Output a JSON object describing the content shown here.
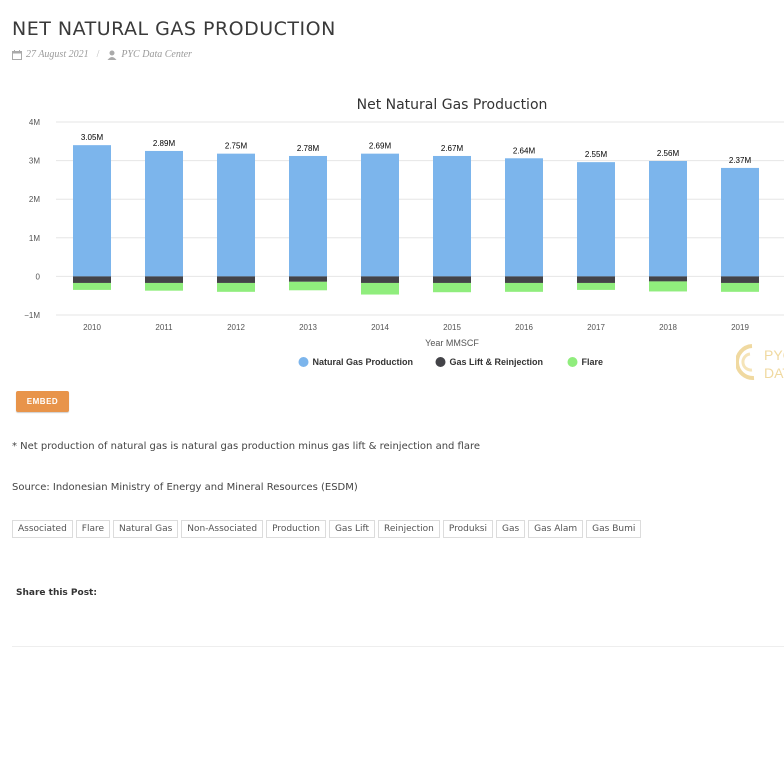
{
  "post": {
    "title": "NET NATURAL GAS PRODUCTION",
    "date": "27 August 2021",
    "author": "PYC Data Center"
  },
  "embed_label": "EMBED",
  "note": "* Net production of natural gas is natural gas production minus gas lift & reinjection and flare",
  "source": "Source: Indonesian Ministry of Energy and Mineral Resources (ESDM)",
  "tags": [
    "Associated",
    "Flare",
    "Natural Gas",
    "Non-Associated",
    "Production",
    "Gas Lift",
    "Reinjection",
    "Produksi",
    "Gas",
    "Gas Alam",
    "Gas Bumi"
  ],
  "share_label": "Share this Post:",
  "watermark_text": "PYC DATA",
  "colors": {
    "natural_gas": "#7cb5ec",
    "gas_lift": "#434348",
    "flare": "#90ed7d",
    "embed": "#e8944a"
  },
  "chart_data": {
    "type": "bar",
    "stacked": true,
    "title": "Net Natural Gas Production",
    "xlabel": "Year MMSCF",
    "ylabel": "",
    "ylim": [
      -1,
      4
    ],
    "yticks": [
      -1,
      0,
      1,
      2,
      3,
      4
    ],
    "ytick_labels": [
      "−1M",
      "0",
      "1M",
      "2M",
      "3M",
      "4M"
    ],
    "categories": [
      "2010",
      "2011",
      "2012",
      "2013",
      "2014",
      "2015",
      "2016",
      "2017",
      "2018",
      "2019"
    ],
    "series": [
      {
        "name": "Natural Gas Production",
        "color": "#7cb5ec",
        "values": [
          3.4,
          3.25,
          3.18,
          3.12,
          3.18,
          3.12,
          3.06,
          2.96,
          2.99,
          2.81
        ]
      },
      {
        "name": "Gas Lift & Reinjection",
        "color": "#434348",
        "values": [
          -0.17,
          -0.17,
          -0.17,
          -0.14,
          -0.17,
          -0.17,
          -0.17,
          -0.17,
          -0.13,
          -0.17
        ]
      },
      {
        "name": "Flare",
        "color": "#90ed7d",
        "values": [
          -0.18,
          -0.2,
          -0.23,
          -0.22,
          -0.3,
          -0.24,
          -0.23,
          -0.18,
          -0.26,
          -0.23
        ]
      }
    ],
    "data_labels": [
      "3.05M",
      "2.89M",
      "2.75M",
      "2.78M",
      "2.69M",
      "2.67M",
      "2.64M",
      "2.55M",
      "2.56M",
      "2.37M"
    ],
    "grid": true,
    "legend_position": "bottom-center"
  }
}
